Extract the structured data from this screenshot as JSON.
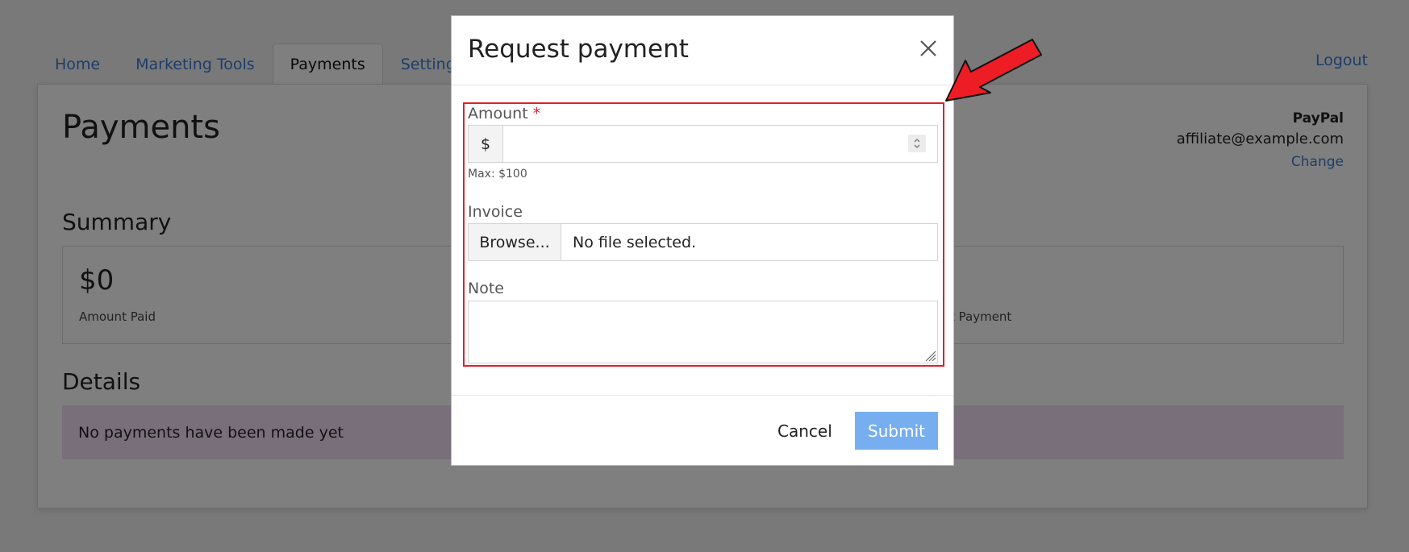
{
  "nav": {
    "tabs": [
      {
        "label": "Home"
      },
      {
        "label": "Marketing Tools"
      },
      {
        "label": "Payments"
      },
      {
        "label": "Settings"
      }
    ],
    "active_tab": "Payments",
    "logout_label": "Logout"
  },
  "page": {
    "title": "Payments",
    "payout": {
      "method": "PayPal",
      "email": "affiliate@example.com",
      "change_label": "Change"
    },
    "summary": {
      "title": "Summary",
      "amount_paid_value": "$0",
      "amount_paid_label": "Amount Paid",
      "partial_label": "t Payment"
    },
    "details": {
      "title": "Details",
      "empty_message": "No payments have been made yet"
    }
  },
  "modal": {
    "title": "Request payment",
    "amount": {
      "label": "Amount",
      "required_mark": "*",
      "currency": "$",
      "value": "",
      "help": "Max: $100"
    },
    "invoice": {
      "label": "Invoice",
      "browse_label": "Browse...",
      "file_status": "No file selected."
    },
    "note": {
      "label": "Note",
      "value": ""
    },
    "cancel_label": "Cancel",
    "submit_label": "Submit"
  },
  "colors": {
    "link": "#3a7bd5",
    "highlight": "#e0202a",
    "submit": "#76aef0",
    "alert_bg": "#f1def4",
    "arrow": "#ee1c25"
  },
  "icons": [
    "close-icon",
    "spinner-icon",
    "resize-grip-icon",
    "annotation-arrow-icon"
  ]
}
